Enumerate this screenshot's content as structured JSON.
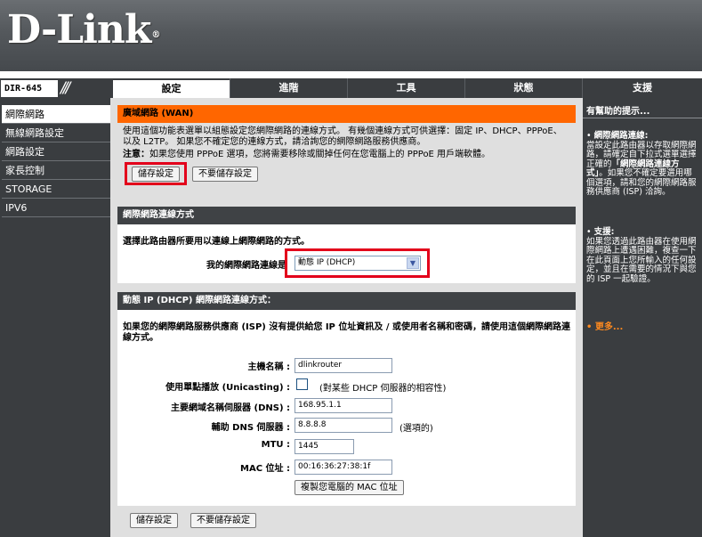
{
  "brand": {
    "logo_text": "D-Link",
    "logo_mark": "®"
  },
  "model": "DIR-645",
  "nav_tabs": [
    {
      "label": "設定",
      "active": true
    },
    {
      "label": "進階",
      "active": false
    },
    {
      "label": "工具",
      "active": false
    },
    {
      "label": "狀態",
      "active": false
    },
    {
      "label": "支援",
      "active": false
    }
  ],
  "sidebar": {
    "items": [
      {
        "label": "網際網路",
        "active": true
      },
      {
        "label": "無線網路設定",
        "active": false
      },
      {
        "label": "網路設定",
        "active": false
      },
      {
        "label": "家長控制",
        "active": false
      },
      {
        "label": "STORAGE",
        "active": false
      },
      {
        "label": "IPV6",
        "active": false
      }
    ]
  },
  "wan": {
    "title": "廣域網路 (WAN)",
    "description": "使用這個功能表選單以組態設定您網際網路的連線方式。 有幾個連線方式可供選擇：固定 IP、DHCP、PPPoE、以及 L2TP。 如果您不確定您的連線方式，請洽詢您的網際網路服務供應商。",
    "note_label": "注意：",
    "note_text": "如果您使用 PPPoE 選項，您將需要移除或關掉任何在您電腦上的 PPPoE 用戶端軟體。",
    "save_label": "儲存設定",
    "dont_save_label": "不要儲存設定"
  },
  "connection_type": {
    "title": "網際網路連線方式",
    "instruction": "選擇此路由器所要用以連線上網際網路的方式。",
    "label": "我的網際網路連線是",
    "selected": "動態 IP (DHCP)"
  },
  "dhcp": {
    "title": "動態 IP (DHCP) 網際網路連線方式：",
    "intro": "如果您的網際網路服務供應商 (ISP) 沒有提供給您 IP 位址資訊及 / 或使用者名稱和密碼，請使用這個網際網路連線方式。",
    "host_name_label": "主機名稱 :",
    "host_name_value": "dlinkrouter",
    "unicast_label": "使用單點播放 (Unicasting) :",
    "unicast_checked": false,
    "unicast_note": "(對某些 DHCP 伺服器的相容性)",
    "dns1_label": "主要網域名稱伺服器 (DNS) :",
    "dns1_value": "168.95.1.1",
    "dns2_label": "輔助 DNS 伺服器 :",
    "dns2_value": "8.8.8.8",
    "dns2_note": "(選項的)",
    "mtu_label": "MTU :",
    "mtu_value": "1445",
    "mac_label": "MAC 位址 :",
    "mac_value": "00:16:36:27:38:1f",
    "clone_mac_label": "複製您電腦的 MAC 位址"
  },
  "footer": {
    "save_label": "儲存設定",
    "dont_save_label": "不要儲存設定"
  },
  "help": {
    "title": "有幫助的提示...",
    "tip1_heading": "網際網路連線:",
    "tip1_text_a": "當設定此路由器以存取網際網路，請確定自下拉式選單選擇正確的",
    "tip1_em": "「網際網路連線方式」",
    "tip1_text_b": "。如果您不確定要選用哪個選項，請和您的網際網路服務供應商 (ISP) 洽詢。",
    "tip2_heading": "支援:",
    "tip2_text": "如果您透過此路由器在使用網際網路上遭遇困難，複查一下在此頁面上您所輸入的任何設定，並且在需要的情況下與您的 ISP 一起驗證。",
    "more": "更多..."
  },
  "colors": {
    "accent_orange": "#ff6600",
    "highlight_red": "#e3001b",
    "dark_bar": "#3a3d40"
  }
}
